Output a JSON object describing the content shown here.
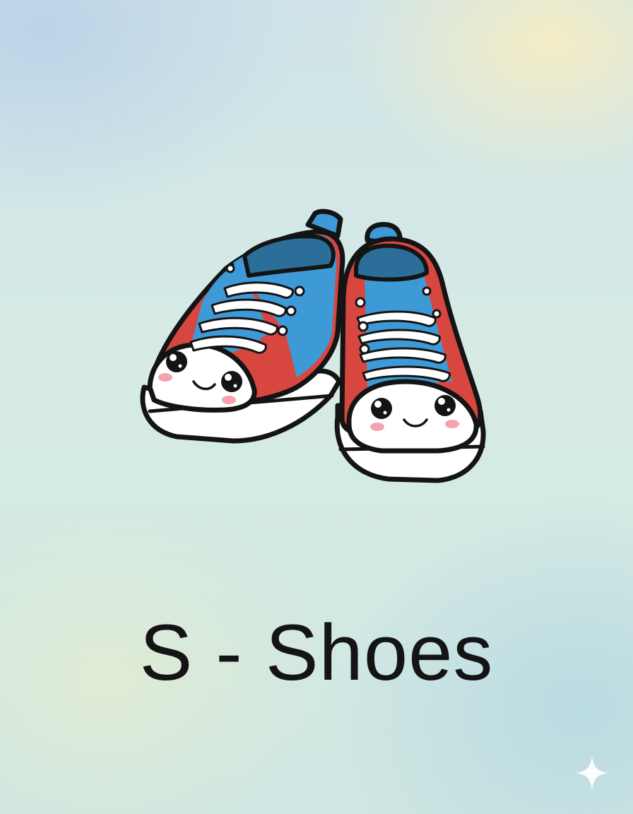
{
  "caption": {
    "letter": "S",
    "separator": "-",
    "word": "Shoes"
  },
  "icons": {
    "illustration": "cartoon-sneakers-icon",
    "corner": "sparkle-icon"
  },
  "colors": {
    "shoe_blue": "#3e9ad6",
    "shoe_red": "#d8473f",
    "sole_white": "#ffffff",
    "outline": "#141414",
    "cheek_pink": "#f4a3ad",
    "caption_text": "#141414"
  }
}
